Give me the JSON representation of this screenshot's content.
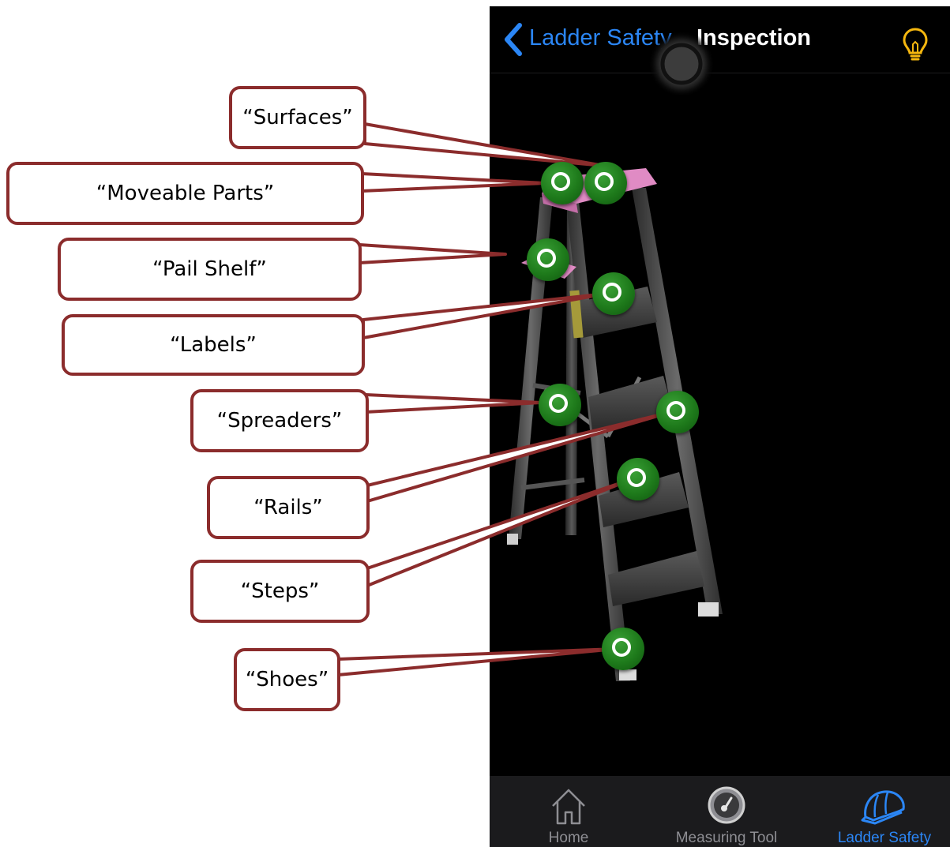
{
  "navbar": {
    "back_label": "Ladder Safety",
    "title": "Inspection",
    "accent_color": "#2b86f5",
    "bulb_icon": "lightbulb-icon",
    "bulb_color": "#f5b70f"
  },
  "callouts": [
    {
      "id": "surfaces",
      "label": "“Surfaces”"
    },
    {
      "id": "moveable-parts",
      "label": "“Moveable  Parts”"
    },
    {
      "id": "pail-shelf",
      "label": "“Pail  Shelf”"
    },
    {
      "id": "labels",
      "label": "“Labels”"
    },
    {
      "id": "spreaders",
      "label": "“Spreaders”"
    },
    {
      "id": "rails",
      "label": "“Rails”"
    },
    {
      "id": "steps",
      "label": "“Steps”"
    },
    {
      "id": "shoes",
      "label": "“Shoes”"
    }
  ],
  "hotspot_color": "#1e7a1b",
  "callout_border_color": "#8b2c2c",
  "tabbar": {
    "tabs": [
      {
        "label": "Home",
        "icon": "home-icon",
        "active": false
      },
      {
        "label": "Measuring Tool",
        "icon": "gauge-icon",
        "active": false
      },
      {
        "label": "Ladder Safety",
        "icon": "hard-hat-icon",
        "active": true
      }
    ]
  }
}
